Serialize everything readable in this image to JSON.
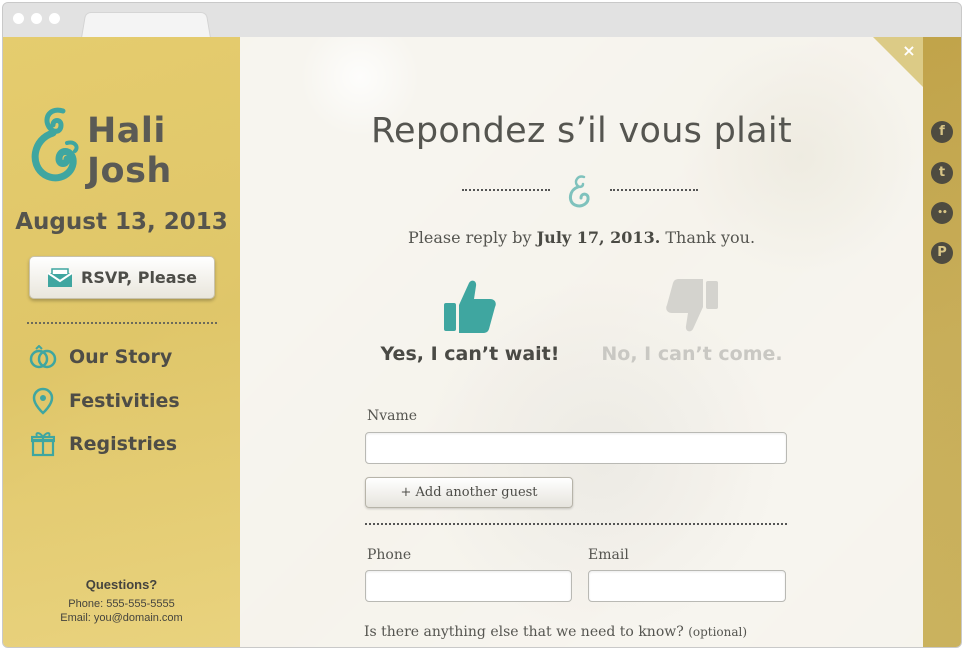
{
  "couple": {
    "name_1": "Hali",
    "name_2": "Josh",
    "date": "August 13, 2013"
  },
  "sidebar": {
    "rsvp_label": "RSVP, Please",
    "nav": [
      {
        "label": "Our Story",
        "icon": "rings-icon"
      },
      {
        "label": "Festivities",
        "icon": "map-pin-icon"
      },
      {
        "label": "Registries",
        "icon": "gift-icon"
      }
    ],
    "questions": {
      "title": "Questions?",
      "phone": "Phone: 555-555-5555",
      "email": "Email: you@domain.com"
    }
  },
  "modal": {
    "title": "Repondez s’il vous plait",
    "reply_prefix": "Please reply by",
    "reply_date": "July 17, 2013.",
    "reply_suffix": "Thank you.",
    "yes_label": "Yes, I can’t wait!",
    "no_label": "No, I can’t come.",
    "close_glyph": "×"
  },
  "form": {
    "name_label": "Nvame",
    "name_value": "",
    "add_guest_label": "+ Add another guest",
    "phone_label": "Phone",
    "phone_value": "",
    "email_label": "Email",
    "email_value": "",
    "notes_label": "Is there anything else that we need to know?",
    "notes_optional": "(optional)"
  },
  "social": [
    {
      "icon": "facebook-icon",
      "glyph": "f"
    },
    {
      "icon": "twitter-icon",
      "glyph": "t"
    },
    {
      "icon": "flickr-icon",
      "glyph": "••"
    },
    {
      "icon": "pinterest-icon",
      "glyph": "P"
    }
  ],
  "colors": {
    "accent_teal": "#3fa6a0",
    "gold": "#d9c478",
    "text": "#555550"
  }
}
